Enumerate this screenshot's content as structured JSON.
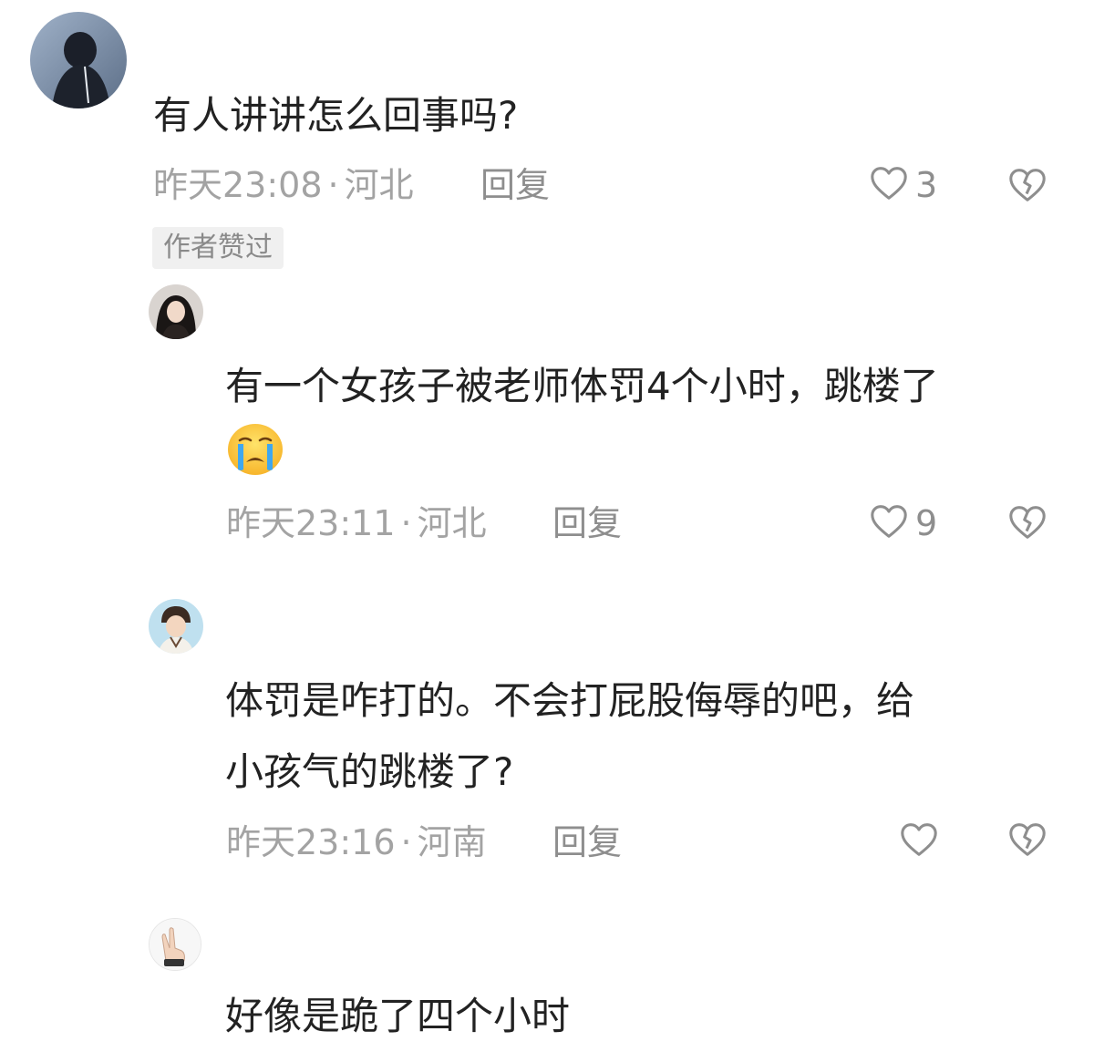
{
  "comments": [
    {
      "text": "有人讲讲怎么回事吗?",
      "time": "昨天23:08",
      "region": "河北",
      "reply_label": "回复",
      "like_count": "3",
      "author_badge": "作者赞过"
    },
    {
      "text_line1": "有一个女孩子被老师体罚4个小时，跳楼了",
      "emoji": "crying-face",
      "time": "昨天23:11",
      "region": "河北",
      "reply_label": "回复",
      "like_count": "9"
    },
    {
      "text_line1": "体罚是咋打的。不会打屁股侮辱的吧，给",
      "text_line2": "小孩气的跳楼了?",
      "time": "昨天23:16",
      "region": "河南",
      "reply_label": "回复",
      "like_count": ""
    },
    {
      "text": "好像是跪了四个小时"
    }
  ],
  "separator": "·",
  "icons": {
    "like": "heart-outline-icon",
    "dislike": "broken-heart-icon"
  },
  "colors": {
    "text": "#222222",
    "meta": "#a3a3a3",
    "icon": "#8e8e8e",
    "badge_bg": "#f0f0f0"
  }
}
